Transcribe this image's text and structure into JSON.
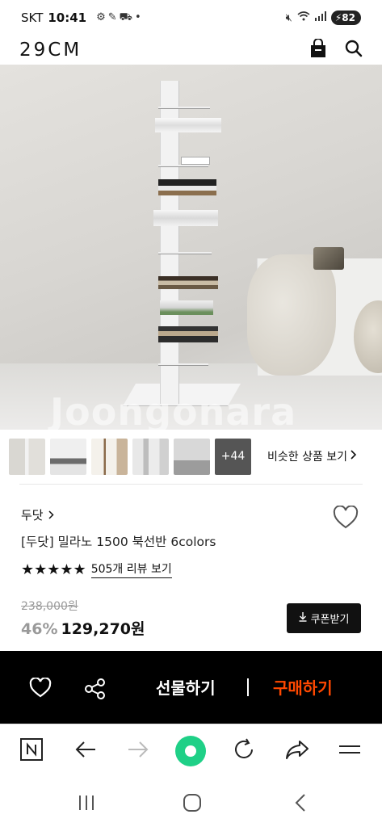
{
  "status_bar": {
    "carrier": "SKT",
    "time": "10:41",
    "battery": "82"
  },
  "header": {
    "logo": "29CM"
  },
  "hero": {
    "watermark": "Joongonara"
  },
  "thumbnails": {
    "more_count": "+44",
    "similar_label": "비슷한 상품 보기"
  },
  "product": {
    "brand": "두닷",
    "name": "[두닷] 밀라노 1500 북선반 6colors",
    "stars": "★★★★★",
    "reviews": "505개 리뷰 보기",
    "original_price": "238,000원",
    "discount": "46%",
    "price": "129,270원",
    "coupon_label": "쿠폰받기"
  },
  "action_bar": {
    "gift_label": "선물하기",
    "buy_label": "구매하기",
    "buy_color": "#ff4800"
  },
  "colors": {
    "accent": "#ff4800",
    "browser_green": "#1fd087"
  }
}
